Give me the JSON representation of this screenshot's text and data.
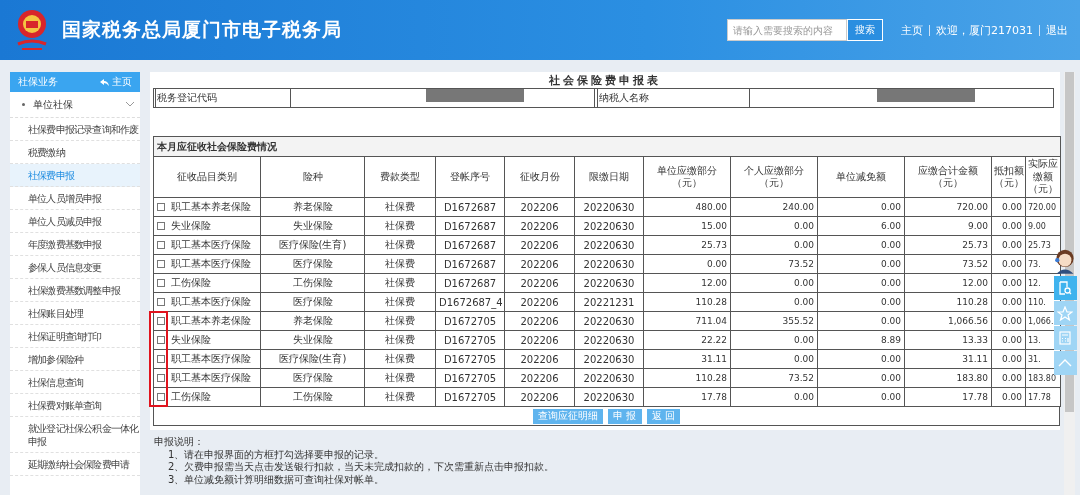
{
  "header": {
    "title": "国家税务总局厦门市电子税务局",
    "search": {
      "placeholder": "请输入需要搜索的内容",
      "button": "搜索"
    },
    "links": [
      "主页",
      "欢迎，厦门217031",
      "退出"
    ]
  },
  "sidebar": {
    "title": "社保业务",
    "home": "主页",
    "group": {
      "label": "单位社保",
      "expanded": true,
      "items": [
        {
          "label": "社保费申报记录查询和作废",
          "selected": false
        },
        {
          "label": "税费缴纳",
          "selected": false
        },
        {
          "label": "社保费申报",
          "selected": true
        },
        {
          "label": "单位人员增员申报",
          "selected": false
        },
        {
          "label": "单位人员减员申报",
          "selected": false
        },
        {
          "label": "年度缴费基数申报",
          "selected": false
        },
        {
          "label": "参保人员信息变更",
          "selected": false
        },
        {
          "label": "社保缴费基数调整申报",
          "selected": false
        },
        {
          "label": "社保账目处理",
          "selected": false
        },
        {
          "label": "社保证明查询打印",
          "selected": false
        },
        {
          "label": "增加参保险种",
          "selected": false
        },
        {
          "label": "社保信息查询",
          "selected": false
        },
        {
          "label": "社保费对账单查询",
          "selected": false
        },
        {
          "label": "就业登记社保公积金一体化申报",
          "selected": false
        },
        {
          "label": "延期缴纳社会保险费申请",
          "selected": false
        }
      ]
    }
  },
  "form": {
    "title": "社会保险费申报表",
    "info": [
      {
        "label": "税务登记代码"
      },
      {
        "label": "纳税人名称"
      }
    ],
    "section": "本月应征收社会保险费情况",
    "columns": [
      "征收品目类别",
      "险种",
      "费款类型",
      "登帐序号",
      "征收月份",
      "限缴日期",
      "单位应缴部分（元）",
      "个人应缴部分（元）",
      "单位减免额",
      "应缴合计金额（元）",
      "抵扣额（元）",
      "实际应缴额（元）"
    ],
    "rows": [
      {
        "checked": false,
        "highlighted": false,
        "cells": [
          "职工基本养老保险",
          "养老保险",
          "社保费",
          "D1672687",
          "202206",
          "20220630",
          "480.00",
          "240.00",
          "0.00",
          "720.00",
          "0.00",
          "720.00"
        ]
      },
      {
        "checked": false,
        "highlighted": false,
        "cells": [
          "失业保险",
          "失业保险",
          "社保费",
          "D1672687",
          "202206",
          "20220630",
          "15.00",
          "0.00",
          "6.00",
          "9.00",
          "0.00",
          "9.00"
        ]
      },
      {
        "checked": false,
        "highlighted": false,
        "cells": [
          "职工基本医疗保险",
          "医疗保险(生育)",
          "社保费",
          "D1672687",
          "202206",
          "20220630",
          "25.73",
          "0.00",
          "0.00",
          "25.73",
          "0.00",
          "25.73"
        ]
      },
      {
        "checked": false,
        "highlighted": false,
        "cells": [
          "职工基本医疗保险",
          "医疗保险",
          "社保费",
          "D1672687",
          "202206",
          "20220630",
          "0.00",
          "73.52",
          "0.00",
          "73.52",
          "0.00",
          "73."
        ]
      },
      {
        "checked": false,
        "highlighted": false,
        "cells": [
          "工伤保险",
          "工伤保险",
          "社保费",
          "D1672687",
          "202206",
          "20220630",
          "12.00",
          "0.00",
          "0.00",
          "12.00",
          "0.00",
          "12."
        ]
      },
      {
        "checked": false,
        "highlighted": false,
        "cells": [
          "职工基本医疗保险",
          "医疗保险",
          "社保费",
          "D1672687_4",
          "202206",
          "20221231",
          "110.28",
          "0.00",
          "0.00",
          "110.28",
          "0.00",
          "110."
        ]
      },
      {
        "checked": false,
        "highlighted": true,
        "cells": [
          "职工基本养老保险",
          "养老保险",
          "社保费",
          "D1672705",
          "202206",
          "20220630",
          "711.04",
          "355.52",
          "0.00",
          "1,066.56",
          "0.00",
          "1,066."
        ]
      },
      {
        "checked": false,
        "highlighted": true,
        "cells": [
          "失业保险",
          "失业保险",
          "社保费",
          "D1672705",
          "202206",
          "20220630",
          "22.22",
          "0.00",
          "8.89",
          "13.33",
          "0.00",
          "13."
        ]
      },
      {
        "checked": false,
        "highlighted": true,
        "cells": [
          "职工基本医疗保险",
          "医疗保险(生育)",
          "社保费",
          "D1672705",
          "202206",
          "20220630",
          "31.11",
          "0.00",
          "0.00",
          "31.11",
          "0.00",
          "31."
        ]
      },
      {
        "checked": false,
        "highlighted": true,
        "cells": [
          "职工基本医疗保险",
          "医疗保险",
          "社保费",
          "D1672705",
          "202206",
          "20220630",
          "110.28",
          "73.52",
          "0.00",
          "183.80",
          "0.00",
          "183.80"
        ]
      },
      {
        "checked": false,
        "highlighted": true,
        "cells": [
          "工伤保险",
          "工伤保险",
          "社保费",
          "D1672705",
          "202206",
          "20220630",
          "17.78",
          "0.00",
          "0.00",
          "17.78",
          "0.00",
          "17.78"
        ]
      }
    ],
    "buttons": [
      "查询应征明细",
      "申 报",
      "返 回"
    ]
  },
  "notes": {
    "title": "申报说明：",
    "lines": [
      "1、请在申报界面的方框打勾选择要申报的记录。",
      "2、欠费申报需当天点击发送银行扣款，当天未完成扣款的，下次需重新点击申报扣款。",
      "3、单位减免额计算明细数据可查询社保对帐单。"
    ]
  }
}
